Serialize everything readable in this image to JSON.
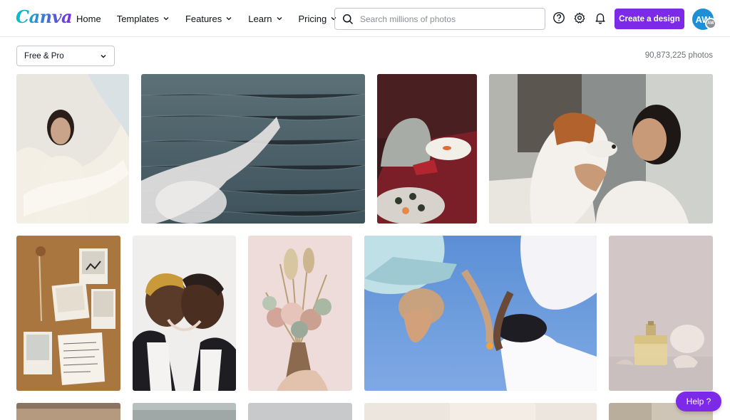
{
  "brand": {
    "logo_text": "Canva",
    "accent": "#7d2ae8"
  },
  "nav": [
    {
      "label": "Home",
      "has_dropdown": false
    },
    {
      "label": "Templates",
      "has_dropdown": true
    },
    {
      "label": "Features",
      "has_dropdown": true
    },
    {
      "label": "Learn",
      "has_dropdown": true
    },
    {
      "label": "Pricing",
      "has_dropdown": true
    }
  ],
  "search": {
    "placeholder": "Search millions of photos",
    "value": ""
  },
  "header_icons": [
    "help-circle-icon",
    "gear-icon",
    "bell-icon"
  ],
  "cta": {
    "label": "Create a design"
  },
  "user": {
    "initials": "AW",
    "sub_initials": "AW"
  },
  "filter": {
    "selected": "Free & Pro"
  },
  "results": {
    "count_text": "90,873,225 photos"
  },
  "help": {
    "label": "Help ?"
  },
  "photos": [
    {
      "subject": "woman-in-white-scarf"
    },
    {
      "subject": "hand-over-sea"
    },
    {
      "subject": "sushi-table"
    },
    {
      "subject": "woman-with-beagle"
    },
    {
      "subject": "corkboard-polaroids"
    },
    {
      "subject": "two-men-foreheads"
    },
    {
      "subject": "dried-flower-bouquet"
    },
    {
      "subject": "women-against-sky"
    },
    {
      "subject": "perfume-bottle"
    },
    {
      "subject": "partial-1"
    },
    {
      "subject": "partial-2"
    },
    {
      "subject": "partial-3"
    },
    {
      "subject": "partial-4"
    },
    {
      "subject": "partial-5"
    }
  ]
}
